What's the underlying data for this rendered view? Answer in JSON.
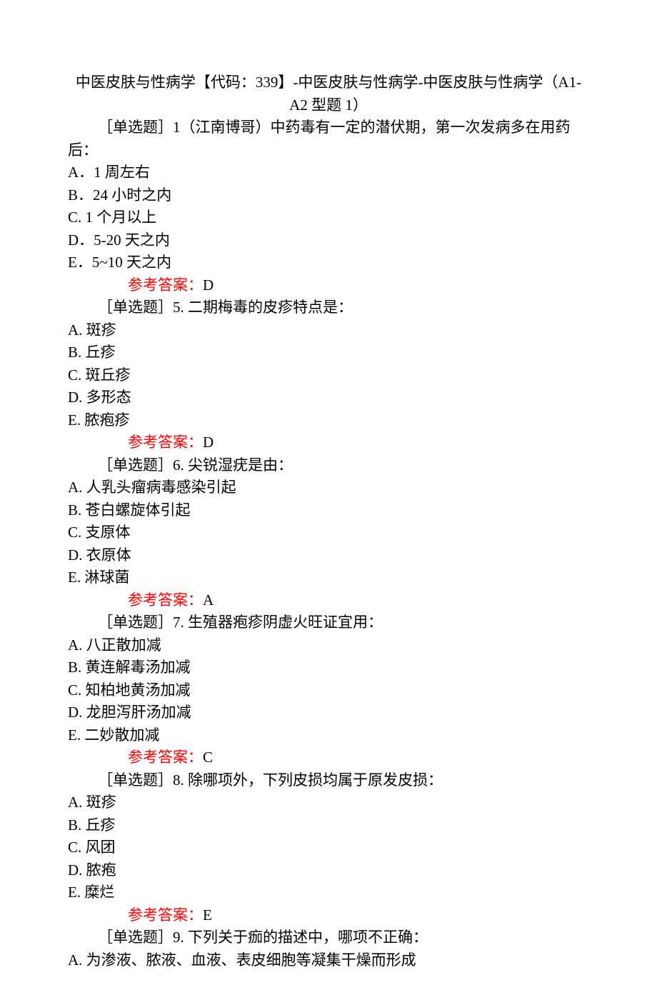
{
  "title_line1": "中医皮肤与性病学【代码：339】-中医皮肤与性病学-中医皮肤与性病学（A1-",
  "title_line2": "A2 型题 1）",
  "answer_label": "参考答案：",
  "questions": [
    {
      "stem": "［单选题］1（江南博哥）中药毒有一定的潜伏期，第一次发病多在用药后：",
      "opts": [
        "A．1 周左右",
        "B．24 小时之内",
        "C. 1 个月以上",
        "D．5-20 天之内",
        "E．5~10 天之内"
      ],
      "answer": "D"
    },
    {
      "stem": "［单选题］5. 二期梅毒的皮疹特点是：",
      "opts": [
        "A. 斑疹",
        "B. 丘疹",
        "C. 斑丘疹",
        "D. 多形态",
        "E. 脓疱疹"
      ],
      "answer": "D"
    },
    {
      "stem": "［单选题］6. 尖锐湿疣是由：",
      "opts": [
        "A. 人乳头瘤病毒感染引起",
        "B. 苍白螺旋体引起",
        "C. 支原体",
        "D. 衣原体",
        "E. 淋球菌"
      ],
      "answer": "A"
    },
    {
      "stem": "［单选题］7. 生殖器疱疹阴虚火旺证宜用：",
      "opts": [
        "A. 八正散加减",
        "B. 黄连解毒汤加减",
        "C. 知柏地黄汤加减",
        "D. 龙胆泻肝汤加减",
        "E. 二妙散加减"
      ],
      "answer": "C"
    },
    {
      "stem": "［单选题］8. 除哪项外，下列皮损均属于原发皮损：",
      "opts": [
        "A. 斑疹",
        "B. 丘疹",
        "C. 风团",
        "D. 脓疱",
        "E. 糜烂"
      ],
      "answer": "E"
    },
    {
      "stem": "［单选题］9. 下列关于痂的描述中，哪项不正确：",
      "opts": [
        "A. 为渗液、脓液、血液、表皮细胞等凝集干燥而形成"
      ],
      "answer": null
    }
  ]
}
